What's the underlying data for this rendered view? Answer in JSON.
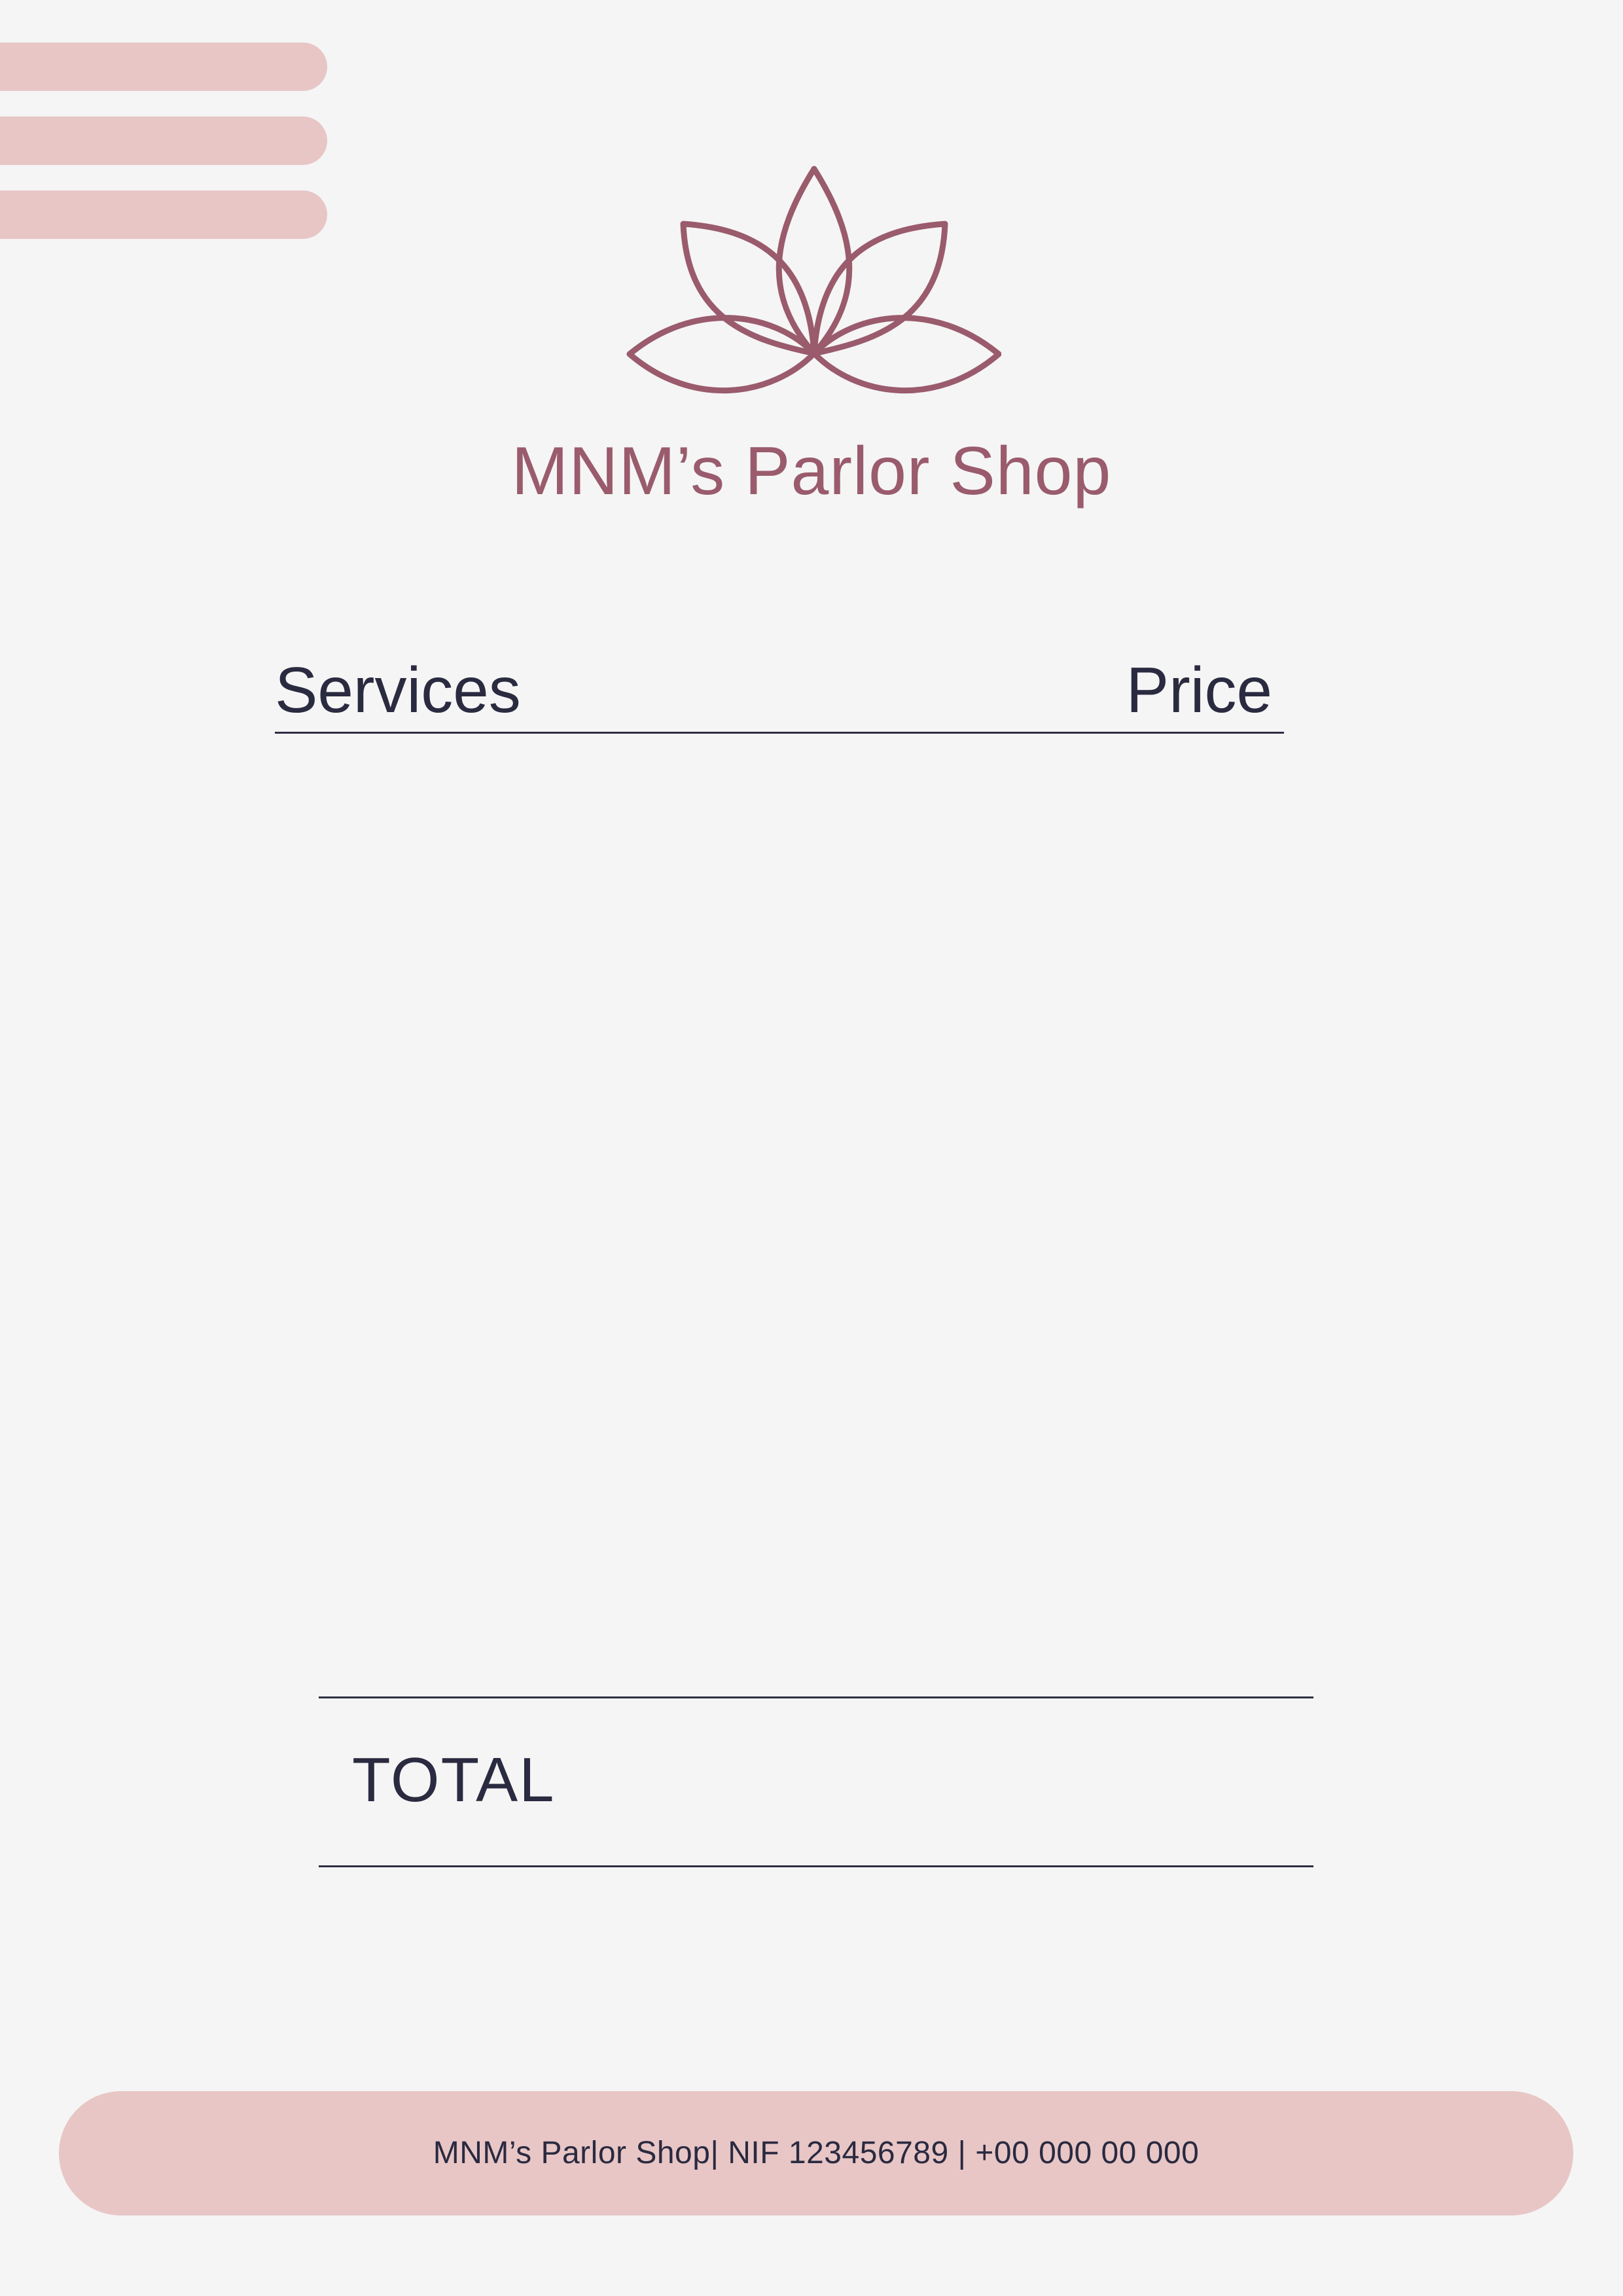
{
  "brand": {
    "name": "MNM’s Parlor Shop",
    "logo_icon": "lotus-icon",
    "accent_color": "#9a5b6d",
    "band_color": "#e8c6c6"
  },
  "table": {
    "services_header": "Services",
    "price_header": "Price"
  },
  "summary": {
    "total_label": "TOTAL"
  },
  "footer": {
    "text": "MNM’s Parlor Shop| NIF 123456789 | +00 000 00 000"
  }
}
